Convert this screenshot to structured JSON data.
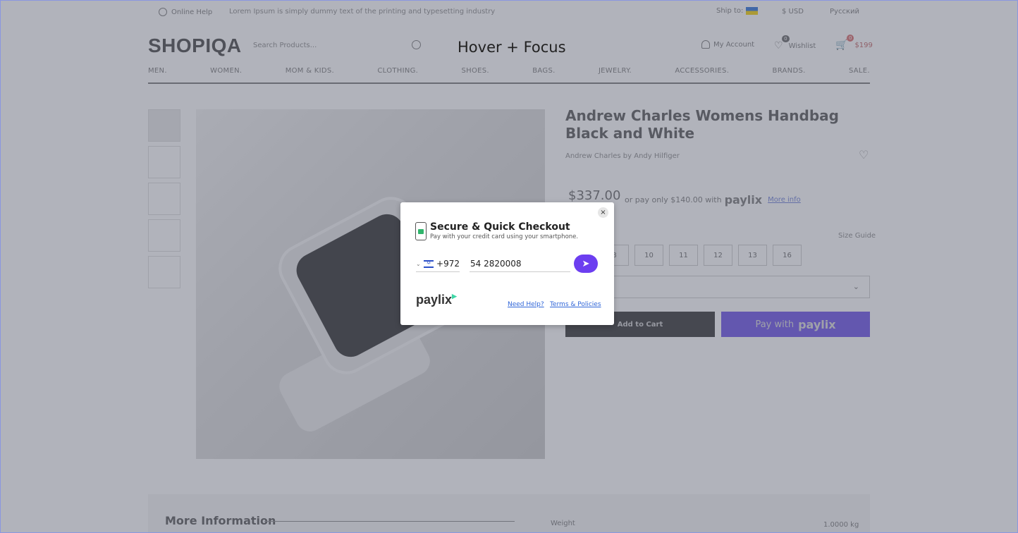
{
  "topbar": {
    "help": "Online Help",
    "tagline": "Lorem Ipsum is simply dummy text of the printing and typesetting industry",
    "ship_to": "Ship to:",
    "currency": "$ USD",
    "language": "Русский"
  },
  "header": {
    "logo": "SHOPIQA",
    "search_placeholder": "Search Products...",
    "account": "My Account",
    "wishlist": "Wishlist",
    "wishlist_count": "0",
    "cart_count": "0",
    "cart_total": "$199"
  },
  "nav": [
    "MEN.",
    "WOMEN.",
    "MOM & KIDS.",
    "CLOTHING.",
    "SHOES.",
    "BAGS.",
    "JEWELRY.",
    "ACCESSORIES.",
    "BRANDS.",
    "SALE."
  ],
  "product": {
    "title": "Andrew Charles Womens Handbag Black and White",
    "brand": "Andrew Charles by Andy Hilfiger",
    "price": "$337.00",
    "pay_only": "or pay only $140.00 with",
    "paylix": "paylix",
    "more_info": "More info",
    "size_guide": "Size Guide",
    "sizes": [
      "8",
      "10",
      "11",
      "12",
      "13",
      "16"
    ],
    "add_to_cart": "Add to Cart",
    "pay_with": "Pay with",
    "more_information": "More Information",
    "weight_label": "Weight",
    "weight_value": "1.0000 kg"
  },
  "overlay_label": "Hover + Focus",
  "modal": {
    "title": "Secure & Quick Checkout",
    "subtitle": "Pay with your credit card using your smartphone.",
    "country_code": "+972",
    "phone_value": "54 2820008",
    "logo": "paylix",
    "need_help": "Need Help?",
    "terms": "Terms & Policies",
    "close": "×",
    "send": "➤"
  },
  "colors": {
    "accent": "#6c3ef0",
    "link": "#2f65d8",
    "overlay": "#5c6070"
  }
}
